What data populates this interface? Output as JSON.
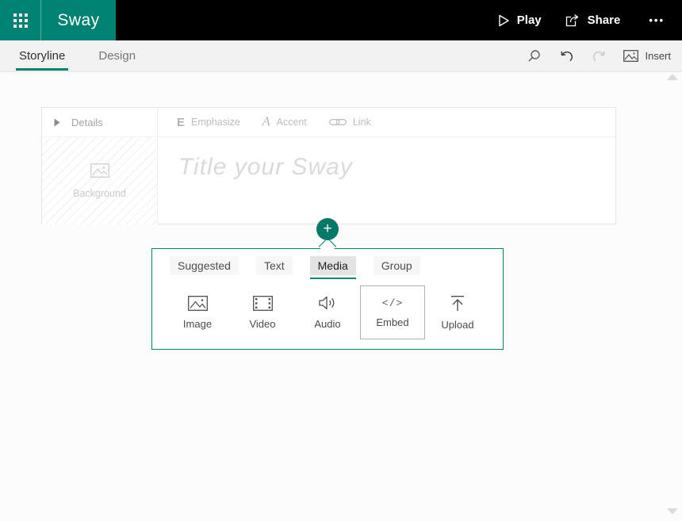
{
  "app": {
    "title": "Sway",
    "play_label": "Play",
    "share_label": "Share",
    "more_label": "•••"
  },
  "nav": {
    "storyline": "Storyline",
    "design": "Design"
  },
  "toolbar": {
    "insert_label": "Insert"
  },
  "storyline_card": {
    "details_label": "Details",
    "emphasize_icon": "E",
    "emphasize_label": "Emphasize",
    "accent_icon": "A",
    "accent_label": "Accent",
    "link_label": "Link",
    "background_label": "Background",
    "title_placeholder": "Title your Sway"
  },
  "add_button": {
    "label": "+"
  },
  "insert_menu": {
    "tabs": {
      "suggested": "Suggested",
      "text": "Text",
      "media": "Media",
      "group": "Group"
    },
    "items": {
      "image": "Image",
      "video": "Video",
      "audio": "Audio",
      "embed": "Embed",
      "upload": "Upload"
    },
    "embed_glyph": "</>"
  },
  "colors": {
    "brand_teal": "#008272",
    "topbar_black": "#000000",
    "subbar_gray": "#f2f2f2",
    "placeholder_gray": "#dadada"
  }
}
